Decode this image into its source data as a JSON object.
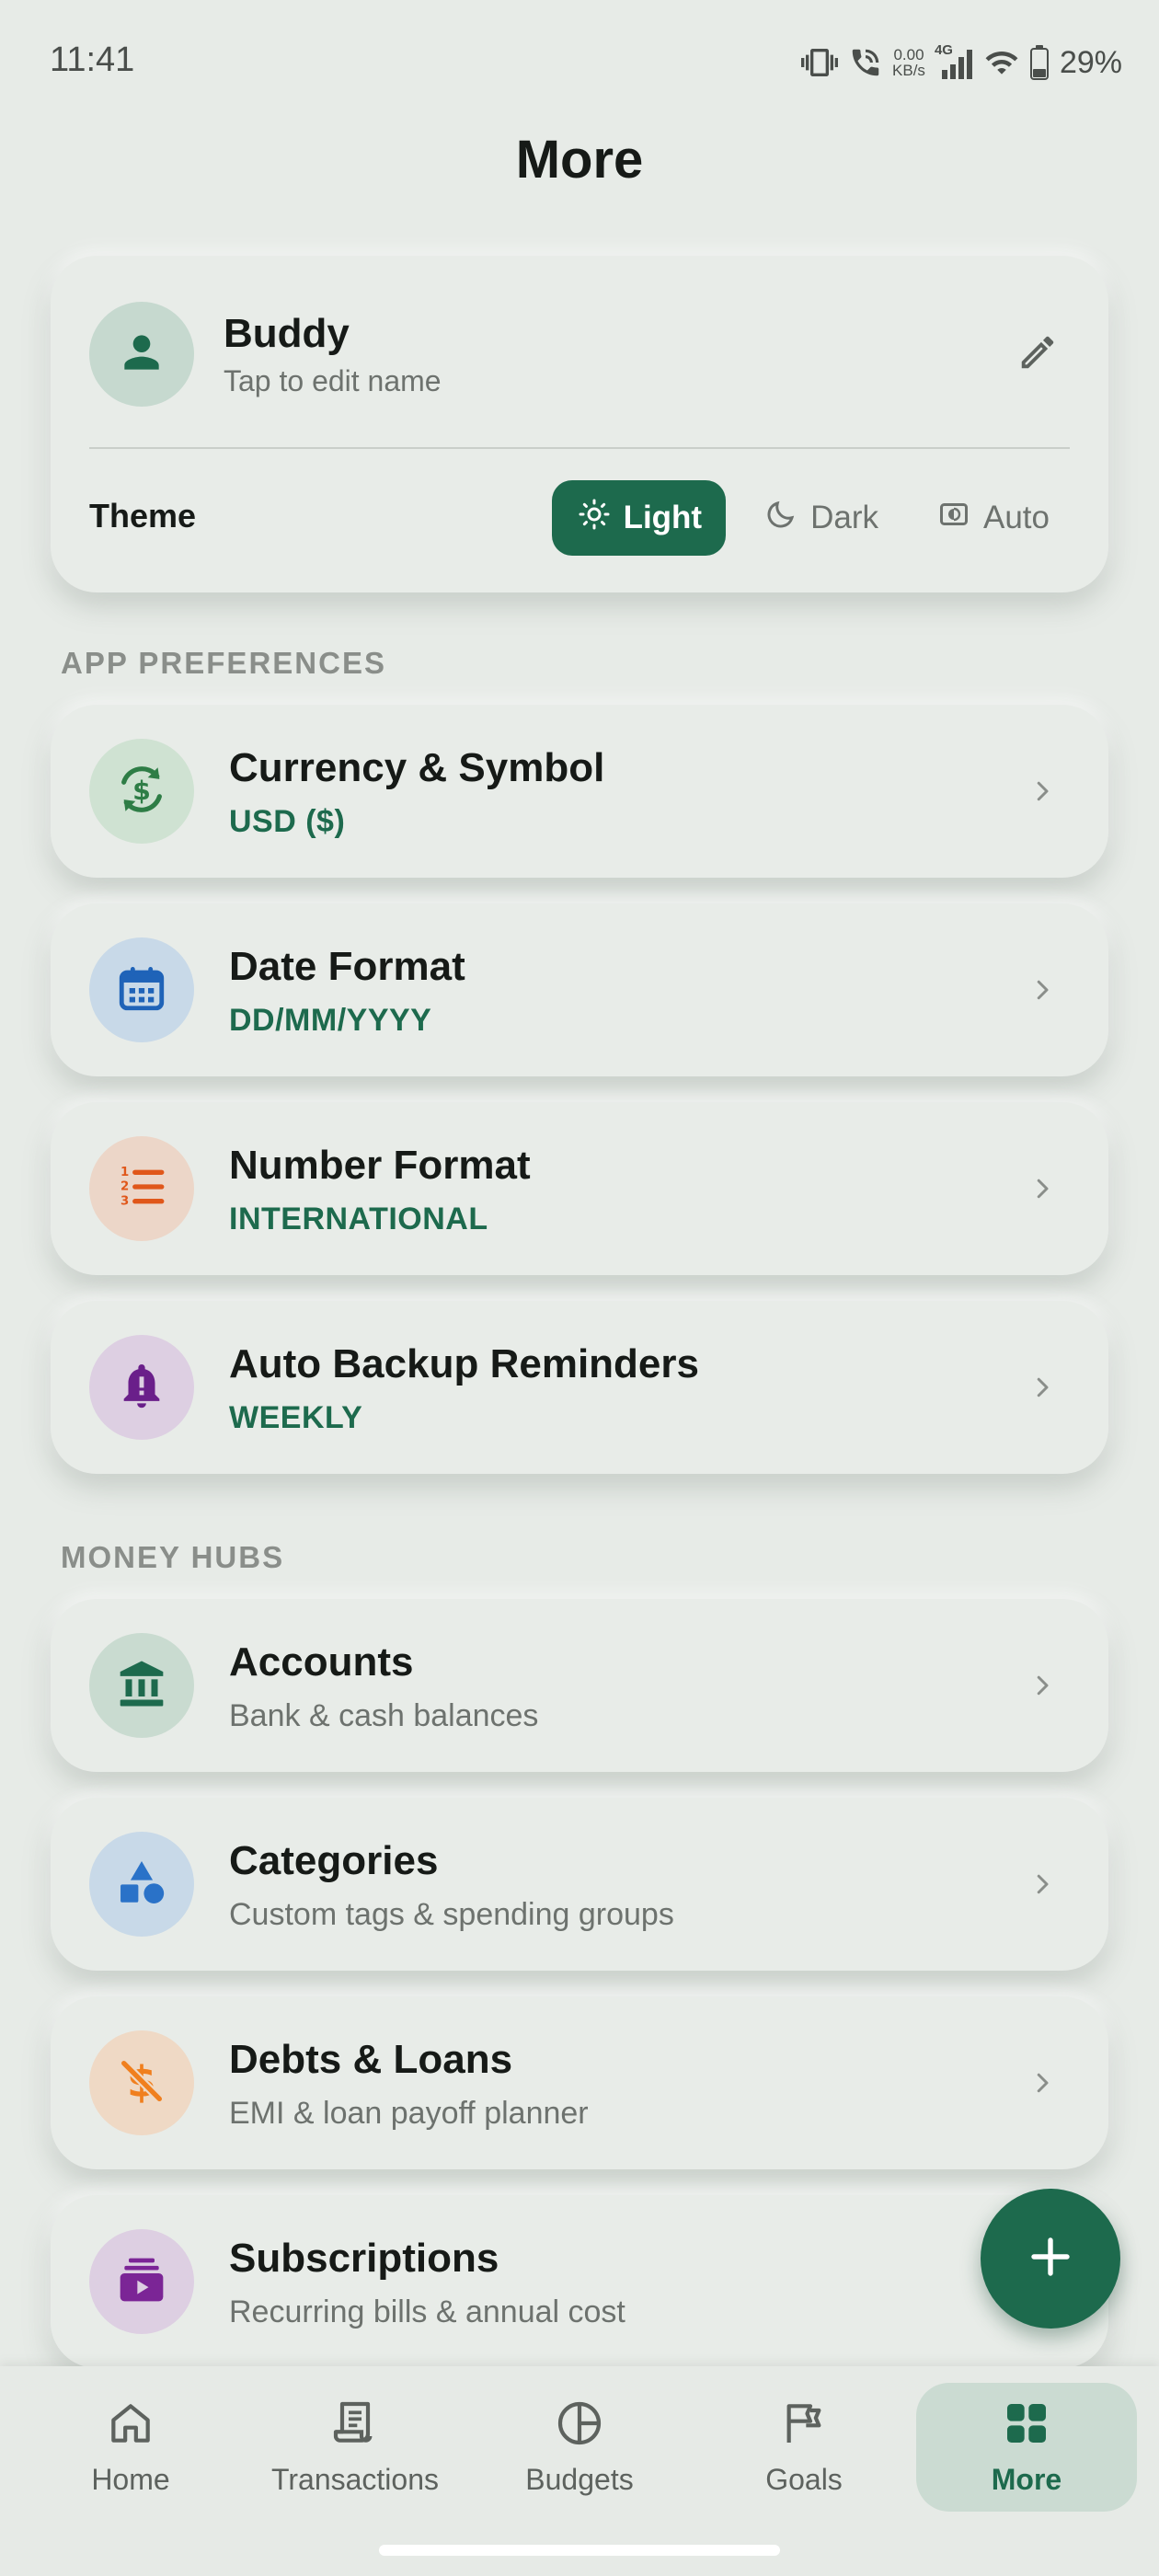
{
  "status_bar": {
    "time": "11:41",
    "net_speed_value": "0.00",
    "net_speed_unit": "KB/s",
    "network_type": "4G",
    "battery": "29%"
  },
  "header": {
    "title": "More"
  },
  "profile": {
    "name": "Buddy",
    "subtitle": "Tap to edit name",
    "theme_label": "Theme",
    "theme_options": [
      {
        "label": "Light",
        "icon": "sun-icon",
        "active": true
      },
      {
        "label": "Dark",
        "icon": "moon-icon",
        "active": false
      },
      {
        "label": "Auto",
        "icon": "auto-contrast-icon",
        "active": false
      }
    ]
  },
  "app_preferences": {
    "section_label": "APP PREFERENCES",
    "items": [
      {
        "title": "Currency & Symbol",
        "value": "USD ($)",
        "icon": "currency-exchange-icon",
        "icon_bg": "#cfe2d2",
        "icon_color": "#2e7d46"
      },
      {
        "title": "Date Format",
        "value": "DD/MM/YYYY",
        "icon": "calendar-icon",
        "icon_bg": "#c8d9e8",
        "icon_color": "#1f63b8"
      },
      {
        "title": "Number Format",
        "value": "INTERNATIONAL",
        "icon": "numbered-list-icon",
        "icon_bg": "#ecd6c8",
        "icon_color": "#e0571a"
      },
      {
        "title": "Auto Backup Reminders",
        "value": "WEEKLY",
        "icon": "bell-alert-icon",
        "icon_bg": "#ddcfe2",
        "icon_color": "#6a1f8a"
      }
    ]
  },
  "money_hubs": {
    "section_label": "MONEY HUBS",
    "items": [
      {
        "title": "Accounts",
        "subtitle": "Bank & cash balances",
        "icon": "bank-icon",
        "icon_bg": "#c9dbd0",
        "icon_color": "#1d6a4d"
      },
      {
        "title": "Categories",
        "subtitle": "Custom tags & spending groups",
        "icon": "shapes-icon",
        "icon_bg": "#c8d9e8",
        "icon_color": "#2a72c8"
      },
      {
        "title": "Debts & Loans",
        "subtitle": "EMI & loan payoff planner",
        "icon": "money-off-icon",
        "icon_bg": "#efd9c5",
        "icon_color": "#f07f1e"
      },
      {
        "title": "Subscriptions",
        "subtitle": "Recurring bills & annual cost",
        "icon": "subscriptions-icon",
        "icon_bg": "#ddcfe2",
        "icon_color": "#7b2596"
      }
    ]
  },
  "bottom_nav": {
    "items": [
      {
        "label": "Home",
        "icon": "home-icon",
        "active": false
      },
      {
        "label": "Transactions",
        "icon": "receipt-icon",
        "active": false
      },
      {
        "label": "Budgets",
        "icon": "pie-chart-icon",
        "active": false
      },
      {
        "label": "Goals",
        "icon": "flag-icon",
        "active": false
      },
      {
        "label": "More",
        "icon": "grid-icon",
        "active": true
      }
    ]
  },
  "colors": {
    "accent": "#1d6a4d",
    "background": "#e7ebe7"
  }
}
